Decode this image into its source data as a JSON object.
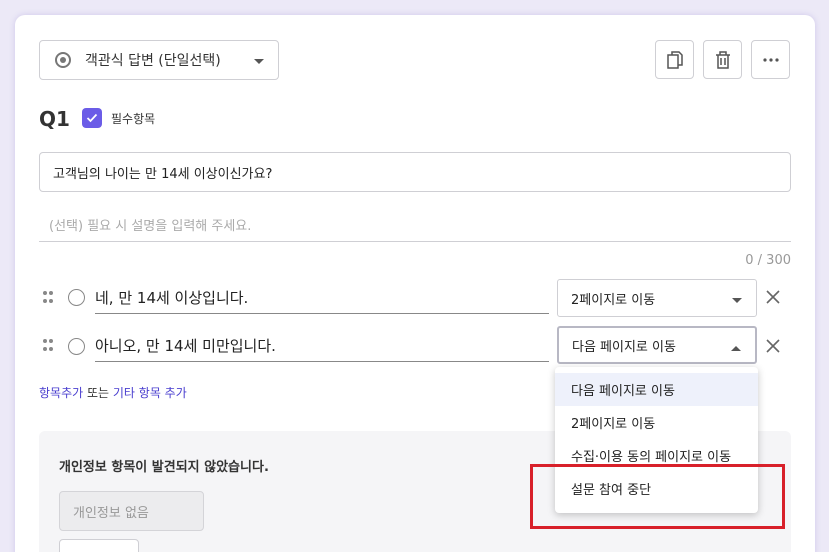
{
  "question_type": {
    "label": "객관식 답변 (단일선택)"
  },
  "toolbar": {
    "copy_icon": "copy-icon",
    "delete_icon": "trash-icon",
    "more_icon": "more-icon"
  },
  "question": {
    "number": "Q1",
    "required_label": "필수항목",
    "required_checked": true,
    "title": "고객님의 나이는 만 14세 이상이신가요?",
    "description_placeholder": "(선택) 필요 시 설명을 입력해 주세요.",
    "char_count": "0 / 300"
  },
  "options": [
    {
      "text": "네, 만 14세 이상입니다.",
      "action": "2페이지로 이동"
    },
    {
      "text": "아니오, 만 14세 미만입니다.",
      "action": "다음 페이지로 이동"
    }
  ],
  "add_links": {
    "add_item": "항목추가",
    "or": " 또는 ",
    "add_other": "기타 항목 추가"
  },
  "privacy": {
    "title": "개인정보 항목이 발견되지 않았습니다.",
    "none_label": "개인정보 없음"
  },
  "dropdown_menu": {
    "items": [
      "다음 페이지로 이동",
      "2페이지로 이동",
      "수집·이용 동의 페이지로 이동",
      "설문 참여 중단"
    ],
    "highlighted_index": 0
  },
  "colors": {
    "accent": "#6b5ce7",
    "link": "#4a3fcf",
    "annotation": "#d8202a"
  }
}
